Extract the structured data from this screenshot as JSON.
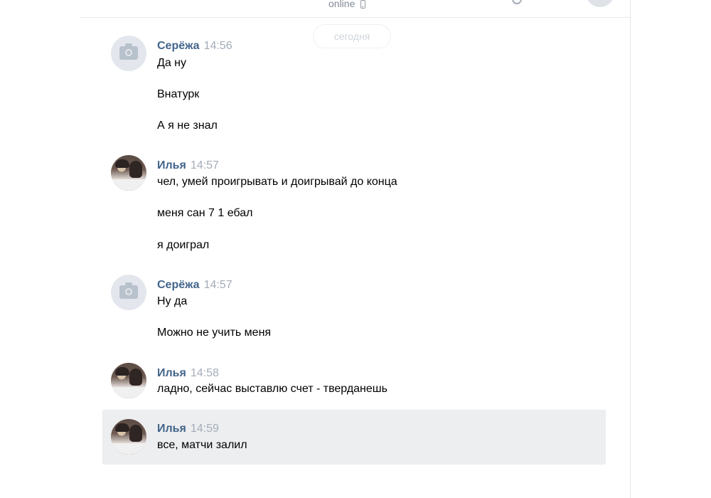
{
  "header": {
    "status": "online"
  },
  "date_separator": "сегодня",
  "groups": [
    {
      "sender": "Серёжа",
      "time": "14:56",
      "messages": [
        "Да ну",
        "Внатурк",
        "А я не знал"
      ]
    },
    {
      "sender": "Илья",
      "time": "14:57",
      "messages": [
        "чел, умей проигрывать и доигрывай до конца",
        "меня сан 7 1 ебал",
        "я доиграл"
      ]
    },
    {
      "sender": "Серёжа",
      "time": "14:57",
      "messages": [
        "Ну да",
        "Можно не учить меня"
      ]
    },
    {
      "sender": "Илья",
      "time": "14:58",
      "messages": [
        "ладно, сейчас выставлю счет - тверданешь"
      ]
    },
    {
      "sender": "Илья",
      "time": "14:59",
      "messages": [
        "все, матчи залил"
      ]
    }
  ]
}
